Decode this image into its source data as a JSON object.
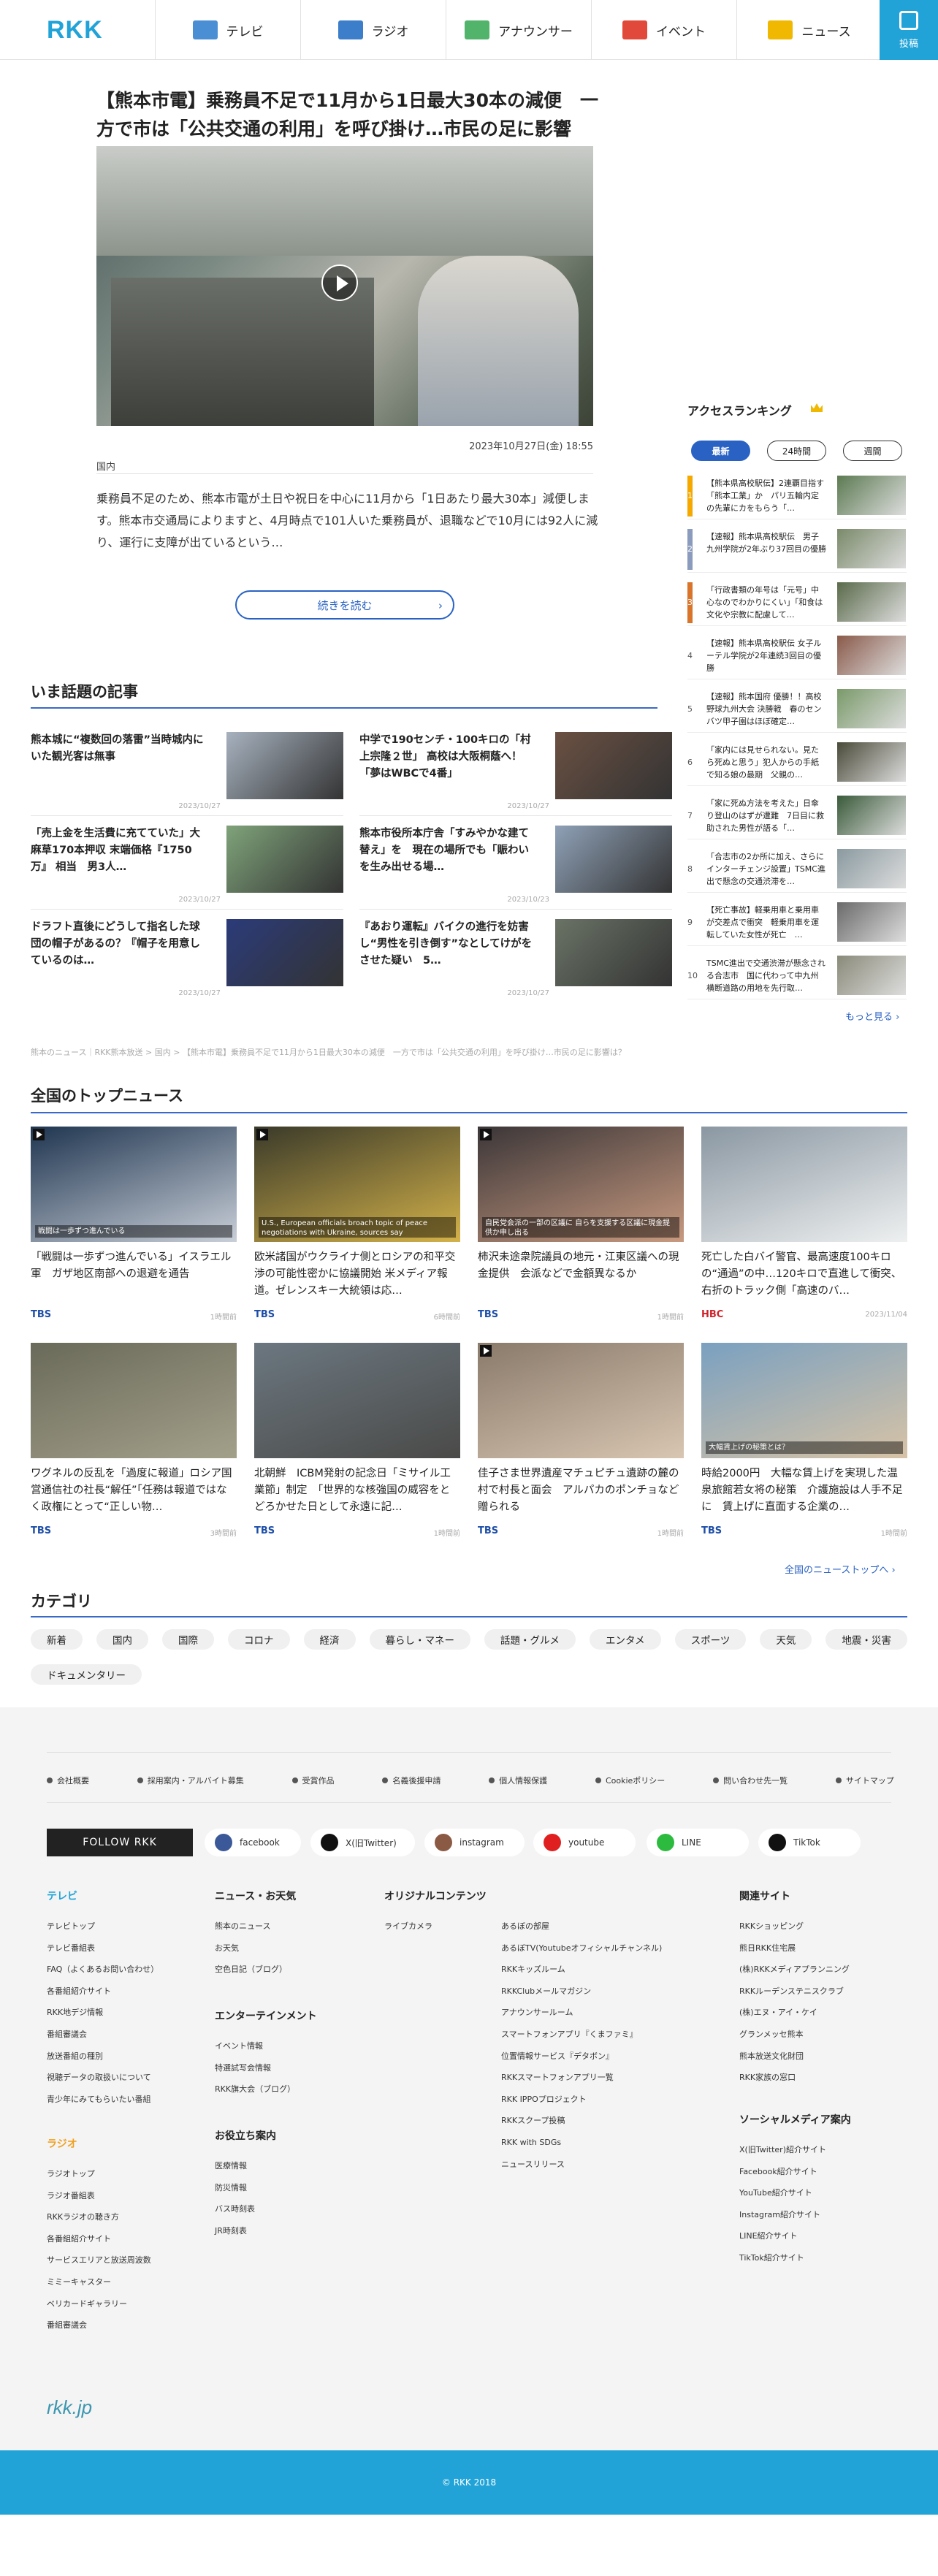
{
  "header": {
    "logo": "RKK",
    "nav": [
      {
        "label": "テレビ",
        "icon": "tv-icon",
        "color": "#4a8fd4"
      },
      {
        "label": "ラジオ",
        "icon": "radio-icon",
        "color": "#3c7ec9"
      },
      {
        "label": "アナウンサー",
        "icon": "microphone-icon",
        "color": "#52b36b"
      },
      {
        "label": "イベント",
        "icon": "event-icon",
        "color": "#e14a3b"
      },
      {
        "label": "ニュース",
        "icon": "news-icon",
        "color": "#f0b800"
      }
    ],
    "post_label": "投稿"
  },
  "hero": {
    "title": "【熊本市電】乗務員不足で11月から1日最大30本の減便　一方で市は「公共交通の利用」を呼び掛け…市民の足に影響は？",
    "date": "2023年10月27日(金) 18:55",
    "category": "国内",
    "summary": "乗務員不足のため、熊本市電が土日や祝日を中心に11月から「1日あたり最大30本」減便します。熊本市交通局によりますと、4月時点で101人いた乗務員が、退職などで10月には92人に減り、運行に支障が出ているという…",
    "read_more": "続きを読む"
  },
  "trending": {
    "title": "いま話題の記事",
    "articles": [
      {
        "title": "熊本城に“複数回の落雷”当時城内にいた観光客は無事",
        "date": "2023/10/27"
      },
      {
        "title": "中学で190センチ・100キロの「村上宗隆２世」 高校は大阪桐蔭へ！「夢はWBCで4番」",
        "date": "2023/10/27"
      },
      {
        "title": "「売上金を生活費に充てていた」大麻草170本押収 末端価格『1750万』 相当　男3人…",
        "date": "2023/10/27"
      },
      {
        "title": "熊本市役所本庁舎「すみやかな建て替え」を　現在の場所でも「賑わいを生み出せる場…",
        "date": "2023/10/23"
      },
      {
        "title": "ドラフト直後にどうして指名した球団の帽子があるの？『帽子を用意しているのは…",
        "date": "2023/10/27"
      },
      {
        "title": "『あおり運転』バイクの進行を妨害し“男性を引き倒す”なとしてけがをさせた疑い　5…",
        "date": "2023/10/27"
      }
    ]
  },
  "ranking": {
    "title": "アクセスランキング",
    "tabs": [
      "最新",
      "24時間",
      "週間"
    ],
    "items": [
      {
        "rank": "1",
        "title": "【熊本県高校駅伝】2連覇目指す「熊本工業」か　パリ五輪内定の先輩にカをもらう「…",
        "color": "#f5a800"
      },
      {
        "rank": "2",
        "title": "【速報】熊本県高校駅伝　男子九州学院が2年ぶり37回目の優勝",
        "color": "#8a9bbd"
      },
      {
        "rank": "3",
        "title": "「行政書類の年号は「元号」中心なのでわかりにくい」「和食は文化や宗教に配慮して…",
        "color": "#d9752b"
      },
      {
        "rank": "4",
        "title": "【速報】熊本県高校駅伝 女子ルーテル学院が2年連続3回目の優勝",
        "color": ""
      },
      {
        "rank": "5",
        "title": "【速報】熊本国府 優勝！！高校野球九州大会 決勝戦　春のセンバツ甲子園はほぼ確定…",
        "color": ""
      },
      {
        "rank": "6",
        "title": "「家内には見せられない。見たら死ぬと思う」犯人からの手紙で知る娘の最期　父親の…",
        "color": ""
      },
      {
        "rank": "7",
        "title": "「家に死ぬ方法を考えた」日傘り登山のはずが遭難　7日目に救助された男性が語る「…",
        "color": ""
      },
      {
        "rank": "8",
        "title": "「合志市の2か所に加え、さらにインターチェンジ設置」TSMC進出で懸念の交通渋滞を…",
        "color": ""
      },
      {
        "rank": "9",
        "title": "【死亡事故】軽乗用車と乗用車が交差点で衝突　軽乗用車を運転していた女性が死亡　…",
        "color": ""
      },
      {
        "rank": "10",
        "title": "TSMC進出で交通渋滞が懸念される合志市　国に代わって中九州横断道路の用地を先行取…",
        "color": ""
      }
    ],
    "more": "もっと見る"
  },
  "breadcrumb": "熊本のニュース｜RKK熊本放送 > 国内 > 【熊本市電】乗務員不足で11月から1日最大30本の減便　一方で市は「公共交通の利用」を呼び掛け…市民の足に影響は？",
  "top_news": {
    "title": "全国のトップニュース",
    "items": [
      {
        "title": "「戦闘は一歩ずつ進んでいる」イスラエル軍　ガザ地区南部への退避を通告",
        "source": "TBS",
        "date": "1時間前",
        "video": true,
        "caption": "戦闘は一歩ずつ進んでいる",
        "src_color": "#1d4ea8"
      },
      {
        "title": "欧米諸国がウクライナ側とロシアの和平交渉の可能性密かに協議開始 米メディア報道。ゼレンスキー大統領は応…",
        "source": "TBS",
        "date": "6時間前",
        "video": true,
        "caption": "U.S., European officials broach topic of peace negotiations with Ukraine, sources say",
        "src_color": "#1d4ea8"
      },
      {
        "title": "柿沢未途衆院議員の地元・江東区議への現金提供　会派などで金額異なるか",
        "source": "TBS",
        "date": "1時間前",
        "video": true,
        "caption": "自民党会派の一部の区議に 自らを支援する区議に現金提供か申し出る",
        "src_color": "#1d4ea8"
      },
      {
        "title": "死亡した白バイ警官、最高速度100キロの“通過”の中…120キロで直進して衝突、右折のトラック側「高速のバ…",
        "source": "HBC",
        "date": "2023/11/04",
        "video": false,
        "caption": "",
        "src_color": "#d0222b"
      },
      {
        "title": "ワグネルの反乱を「過度に報道」ロシア国営通信社の社長“解任”「任務は報道ではなく政権にとって“正しい物…",
        "source": "TBS",
        "date": "3時間前",
        "video": false,
        "caption": "",
        "src_color": "#1d4ea8"
      },
      {
        "title": "北朝鮮　ICBM発射の記念日「ミサイル工業節」制定　「世界的な核強国の威容をとどろかせた日として永遠に記…",
        "source": "TBS",
        "date": "1時間前",
        "video": false,
        "caption": "",
        "src_color": "#1d4ea8"
      },
      {
        "title": "佳子さま世界遺産マチュピチュ遺跡の麓の村で村長と面会　アルパカのポンチョなど贈られる",
        "source": "TBS",
        "date": "1時間前",
        "video": true,
        "caption": "",
        "src_color": "#1d4ea8"
      },
      {
        "title": "時給2000円　大幅な賃上げを実現した温泉旅館若女将の秘策　介護施設は人手不足に　賃上げに直面する企業の…",
        "source": "TBS",
        "date": "1時間前",
        "video": false,
        "caption": "大幅賃上げの秘策とは？",
        "src_color": "#1d4ea8"
      }
    ],
    "more": "全国のニューストップへ"
  },
  "categories": {
    "title": "カテゴリ",
    "items": [
      "新着",
      "国内",
      "国際",
      "コロナ",
      "経済",
      "暮らし・マネー",
      "話題・グルメ",
      "エンタメ",
      "スポーツ",
      "天気",
      "地震・災害",
      "ドキュメンタリー"
    ]
  },
  "footer": {
    "links": [
      "会社概要",
      "採用案内・アルバイト募集",
      "受賞作品",
      "名義後援申請",
      "個人情報保護",
      "Cookieポリシー",
      "問い合わせ先一覧",
      "サイトマップ"
    ],
    "follow": "FOLLOW RKK",
    "sns": [
      {
        "label": "facebook",
        "color": "#3b5998"
      },
      {
        "label": "X(旧Twitter)",
        "color": "#111111"
      },
      {
        "label": "instagram",
        "color": "#8a5a44"
      },
      {
        "label": "youtube",
        "color": "#e02020"
      },
      {
        "label": "LINE",
        "color": "#2dbb3f"
      },
      {
        "label": "TikTok",
        "color": "#111111"
      }
    ],
    "tv": {
      "title": "テレビ",
      "items": [
        "テレビトップ",
        "テレビ番組表",
        "FAQ（よくあるお問い合わせ）",
        "各番組紹介サイト",
        "RKK地デジ情報",
        "番組審議会",
        "放送番組の種別",
        "視聴データの取扱いについて",
        "青少年にみてもらいたい番組"
      ]
    },
    "radio": {
      "title": "ラジオ",
      "items": [
        "ラジオトップ",
        "ラジオ番組表",
        "RKKラジオの聴き方",
        "各番組紹介サイト",
        "サービスエリアと放送周波数",
        "ミミーキャスター",
        "ベリカードギャラリー",
        "番組審議会"
      ]
    },
    "news": {
      "title": "ニュース・お天気",
      "items": [
        "熊本のニュース",
        "お天気",
        "空色日記（ブログ）"
      ]
    },
    "ent": {
      "title": "エンターテインメント",
      "items": [
        "イベント情報",
        "特選試写会情報",
        "RKK旗大会（ブログ）"
      ]
    },
    "useful": {
      "title": "お役立ち案内",
      "items": [
        "医療情報",
        "防災情報",
        "バス時刻表",
        "JR時刻表"
      ]
    },
    "original": {
      "title": "オリジナルコンテンツ",
      "items": [
        "ライブカメラ"
      ]
    },
    "original2": {
      "items": [
        "あるぼの部屋",
        "あるぼTV(Youtubeオフィシャルチャンネル)",
        "RKKキッズルーム",
        "RKKClubメールマガジン",
        "アナウンサールーム",
        "スマートフォンアプリ『くまファミ』",
        "位置情報サービス『デタボン』",
        "RKKスマートフォンアプリ一覧",
        "RKK IPPOプロジェクト",
        "RKKスクープ投稿",
        "RKK with SDGs",
        "ニュースリリース"
      ]
    },
    "related": {
      "title": "関連サイト",
      "items": [
        "RKKショッピング",
        "熊日RKK住宅展",
        "(株)RKKメディアプランニング",
        "RKKルーデンステニスクラブ",
        "(株)エヌ・アイ・ケイ",
        "グランメッセ熊本",
        "熊本放送文化財団",
        "RKK家族の窓口"
      ]
    },
    "social": {
      "title": "ソーシャルメディア案内",
      "items": [
        "X(旧Twitter)紹介サイト",
        "Facebook紹介サイト",
        "YouTube紹介サイト",
        "Instagram紹介サイト",
        "LINE紹介サイト",
        "TikTok紹介サイト"
      ]
    },
    "logo": "rkk.jp",
    "copyright": "© RKK 2018"
  }
}
